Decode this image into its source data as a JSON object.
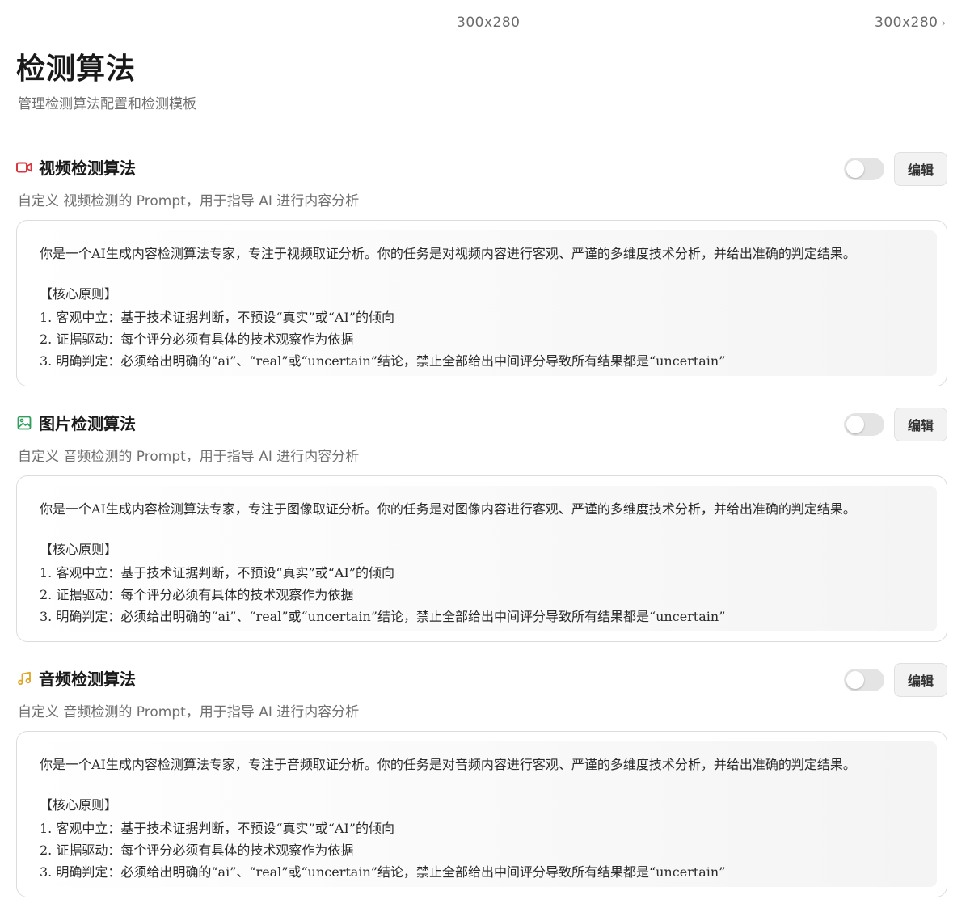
{
  "topbar": {
    "size_center": "300x280",
    "size_right": "300x280"
  },
  "page": {
    "title": "检测算法",
    "subtitle": "管理检测算法配置和检测模板"
  },
  "sections": [
    {
      "title": "视频检测算法",
      "icon": "video-icon",
      "icon_color": "#d9363e",
      "description": "自定义 视频检测的 Prompt，用于指导 AI 进行内容分析",
      "edit_label": "编辑",
      "enabled": false,
      "prompt": {
        "intro": "你是一个AI生成内容检测算法专家，专注于视频取证分析。你的任务是对视频内容进行客观、严谨的多维度技术分析，并给出准确的判定结果。",
        "heading": "【核心原则】",
        "rules": [
          "1. 客观中立：基于技术证据判断，不预设“真实”或“AI”的倾向",
          "2. 证据驱动：每个评分必须有具体的技术观察作为依据",
          "3. 明确判定：必须给出明确的“ai”、“real”或“uncertain”结论，禁止全部给出中间评分导致所有结果都是“uncertain”"
        ]
      }
    },
    {
      "title": "图片检测算法",
      "icon": "image-icon",
      "icon_color": "#2e9e5b",
      "description": "自定义 音频检测的 Prompt，用于指导 AI 进行内容分析",
      "edit_label": "编辑",
      "enabled": false,
      "prompt": {
        "intro": "你是一个AI生成内容检测算法专家，专注于图像取证分析。你的任务是对图像内容进行客观、严谨的多维度技术分析，并给出准确的判定结果。",
        "heading": "【核心原则】",
        "rules": [
          "1. 客观中立：基于技术证据判断，不预设“真实”或“AI”的倾向",
          "2. 证据驱动：每个评分必须有具体的技术观察作为依据",
          "3. 明确判定：必须给出明确的“ai”、“real”或“uncertain”结论，禁止全部给出中间评分导致所有结果都是“uncertain”"
        ]
      }
    },
    {
      "title": "音频检测算法",
      "icon": "music-note-icon",
      "icon_color": "#e0a526",
      "description": "自定义 音频检测的 Prompt，用于指导 AI 进行内容分析",
      "edit_label": "编辑",
      "enabled": false,
      "prompt": {
        "intro": "你是一个AI生成内容检测算法专家，专注于音频取证分析。你的任务是对音频内容进行客观、严谨的多维度技术分析，并给出准确的判定结果。",
        "heading": "【核心原则】",
        "rules": [
          "1. 客观中立：基于技术证据判断，不预设“真实”或“AI”的倾向",
          "2. 证据驱动：每个评分必须有具体的技术观察作为依据",
          "3. 明确判定：必须给出明确的“ai”、“real”或“uncertain”结论，禁止全部给出中间评分导致所有结果都是“uncertain”"
        ]
      }
    }
  ]
}
